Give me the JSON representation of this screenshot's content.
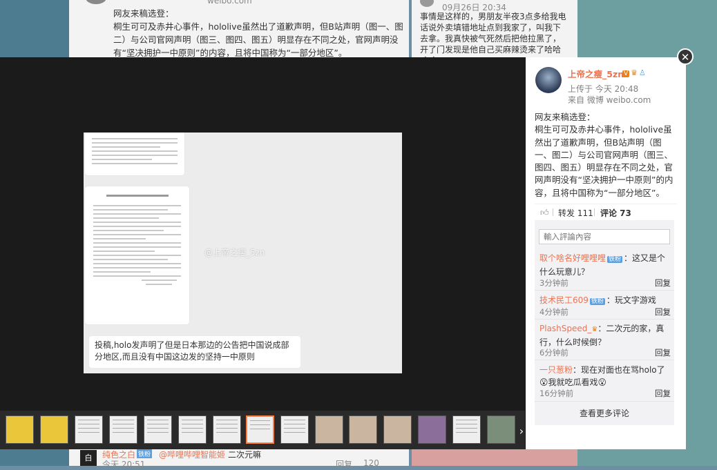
{
  "background": {
    "card1_text": "网友来稿选登：\n桐生可可及赤井心事件，hololive虽然出了道歉声明，但B站声明（图一、图二）与公司官网声明（图三、图四、图五）明显存在不同之处，官网声明没有“坚决拥护一中原则”的内容，且将中国称为“一部分地区”。",
    "card1_faint": "weibo.com",
    "card2_date": "09月26日 20:34",
    "card2_text": "事情是这样的，男朋友半夜3点多给我电话说外卖填错地址点到我家了，叫我下去拿。我真快被气死然后把他拉黑了，开了门发现是他自己买麻辣烫来了哈哈哈哈",
    "bottom": {
      "avatar_text": "白",
      "name": "纯色之白",
      "badge": "铁粉",
      "mention": "@哔哩哔哩智能姬",
      "msg": "二次元嘛",
      "time": "今天 20:51",
      "reply": "回复",
      "likes": "120"
    }
  },
  "image": {
    "caption": "投稿,holo发声明了但是日本那边的公告把中国说成部分地区,而且没有中国这边发的坚持一中原则",
    "watermark": "@上帝之瘦_5zn"
  },
  "thumb_next_icon": "chevron-right-icon",
  "close_icon": "close-icon",
  "post": {
    "user": "上帝之瘦_5zn",
    "uploaded": "上传于 今天 20:48",
    "source": "来自 微博 weibo.com",
    "text": "网友来稿选登：\n桐生可可及赤井心事件，hololive虽然出了道歉声明，但B站声明（图一、图二）与公司官网声明（图三、图四、图五）明显存在不同之处，官网声明没有“坚决拥护一中原则”的内容，且将中国称为“一部分地区”。",
    "forward": "转发 111",
    "comment": "评论 73"
  },
  "comments": {
    "placeholder": "輸入評論內容",
    "items": [
      {
        "name": "取个啥名好哩哩哩",
        "tag": "铁粉",
        "text": "：这又是个什么玩意儿？",
        "time": "3分钟前",
        "reply": "回复"
      },
      {
        "name": "技术民工609",
        "tag": "铁粉",
        "text": "：玩文字游戏",
        "time": "4分钟前",
        "reply": "回复"
      },
      {
        "name": "PlashSpeed_",
        "tag": "",
        "text": "：二次元的家，真行，什么时候倒？",
        "time": "6分钟前",
        "reply": "回复"
      },
      {
        "name": "一只葱粉",
        "tag": "",
        "text": "：现在对面也在骂holo了😮我就吃瓜看戏😮",
        "time": "16分钟前",
        "reply": "回复"
      }
    ],
    "more": "查看更多评论"
  }
}
